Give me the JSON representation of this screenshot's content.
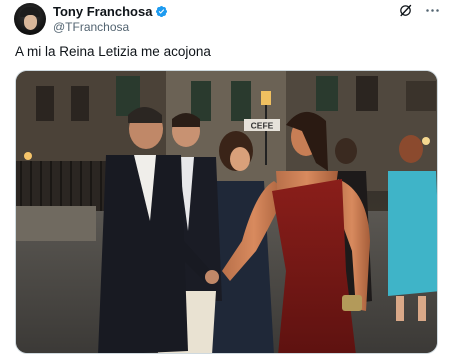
{
  "author": {
    "display_name": "Tony Franchosa",
    "handle": "@TFranchosa",
    "verified": true,
    "avatar_icon": "profile-photo-avatar"
  },
  "header_actions": {
    "grok_icon": "grok-icon",
    "more_icon": "more-options-icon"
  },
  "tweet": {
    "text": "A mi la Reina Letizia me acojona"
  },
  "media": {
    "sign_text": "CEFE"
  },
  "colors": {
    "verified_blue": "#1d9bf0",
    "secondary_text": "#536471"
  }
}
